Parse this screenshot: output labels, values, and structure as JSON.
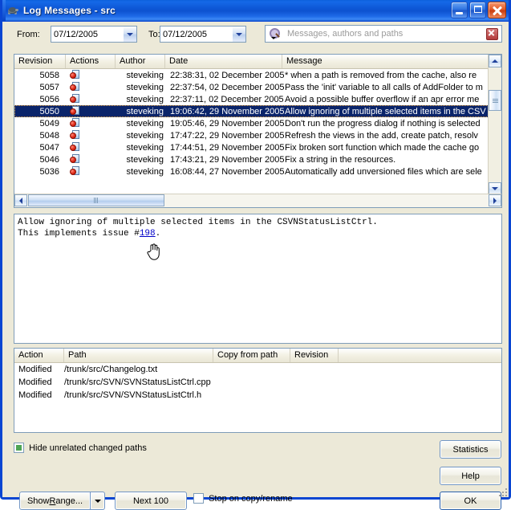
{
  "window": {
    "title": "Log Messages",
    "separator": " - ",
    "subject": "src",
    "icon": "turtle-icon",
    "buttons": {
      "minimize": "minimize-button",
      "maximize": "maximize-button",
      "close": "close-button"
    }
  },
  "toolbar": {
    "from_label": "From:",
    "from_value": "07/12/2005",
    "to_label": "To:",
    "to_value": "07/12/2005",
    "search_placeholder": "Messages, authors and paths",
    "search_value": "",
    "search_icon": "magnifier-icon",
    "clear_icon": "clear-search-icon"
  },
  "revision_list": {
    "columns": [
      "Revision",
      "Actions",
      "Author",
      "Date",
      "Message"
    ],
    "rows": [
      {
        "revision": "5058",
        "action_icon": "modified-icon",
        "author": "steveking",
        "date": "22:38:31, 02 December 2005",
        "message": "* when a path is removed from the cache, also re",
        "selected": false
      },
      {
        "revision": "5057",
        "action_icon": "modified-icon",
        "author": "steveking",
        "date": "22:37:54, 02 December 2005",
        "message": "Pass the 'init' variable to all calls of AddFolder to m",
        "selected": false
      },
      {
        "revision": "5056",
        "action_icon": "modified-icon",
        "author": "steveking",
        "date": "22:37:11, 02 December 2005",
        "message": "Avoid a possible buffer overflow if an apr error me",
        "selected": false
      },
      {
        "revision": "5050",
        "action_icon": "modified-icon",
        "author": "steveking",
        "date": "19:06:42, 29 November 2005",
        "message": "Allow ignoring of multiple selected items in the CSV",
        "selected": true
      },
      {
        "revision": "5049",
        "action_icon": "modified-icon",
        "author": "steveking",
        "date": "19:05:46, 29 November 2005",
        "message": "Don't run the progress dialog if nothing is selected",
        "selected": false
      },
      {
        "revision": "5048",
        "action_icon": "modified-icon",
        "author": "steveking",
        "date": "17:47:22, 29 November 2005",
        "message": "Refresh the views in the add, create patch, resolv",
        "selected": false
      },
      {
        "revision": "5047",
        "action_icon": "modified-icon",
        "author": "steveking",
        "date": "17:44:51, 29 November 2005",
        "message": "Fix broken sort function which made the cache go",
        "selected": false
      },
      {
        "revision": "5046",
        "action_icon": "modified-icon",
        "author": "steveking",
        "date": "17:43:21, 29 November 2005",
        "message": "Fix a string in the resources.",
        "selected": false
      },
      {
        "revision": "5036",
        "action_icon": "modified-icon",
        "author": "steveking",
        "date": "16:08:44, 27 November 2005",
        "message": "Automatically add unversioned files which are sele",
        "selected": false
      }
    ]
  },
  "message_detail": {
    "line1": "Allow ignoring of multiple selected items in the CSVNStatusListCtrl.",
    "line2_prefix": "This implements issue #",
    "issue_link": "198",
    "line2_suffix": ".",
    "cursor": "hand-cursor"
  },
  "paths_list": {
    "columns": [
      "Action",
      "Path",
      "Copy from path",
      "Revision"
    ],
    "rows": [
      {
        "action": "Modified",
        "path": "/trunk/src/Changelog.txt",
        "copy_from_path": "",
        "revision": ""
      },
      {
        "action": "Modified",
        "path": "/trunk/src/SVN/SVNStatusListCtrl.cpp",
        "copy_from_path": "",
        "revision": ""
      },
      {
        "action": "Modified",
        "path": "/trunk/src/SVN/SVNStatusListCtrl.h",
        "copy_from_path": "",
        "revision": ""
      }
    ]
  },
  "footer": {
    "hide_unrelated_label": "Hide unrelated changed paths",
    "hide_unrelated_checked": true,
    "stop_on_copy_label": "Stop on copy/rename",
    "stop_on_copy_checked": false,
    "show_range_label_pre": "Show ",
    "show_range_accel": "R",
    "show_range_label_post": "ange...",
    "next_100_label": "Next 100",
    "statistics_label": "Statistics",
    "help_label": "Help",
    "ok_label": "OK"
  },
  "colors": {
    "titlebar_blue": "#0d57d6",
    "window_border": "#0a46d2",
    "dialog_face": "#ece9d8",
    "selection_blue": "#0a246a",
    "link_blue": "#0000c8",
    "check_green": "#4ea555",
    "close_red": "#c83c10"
  }
}
